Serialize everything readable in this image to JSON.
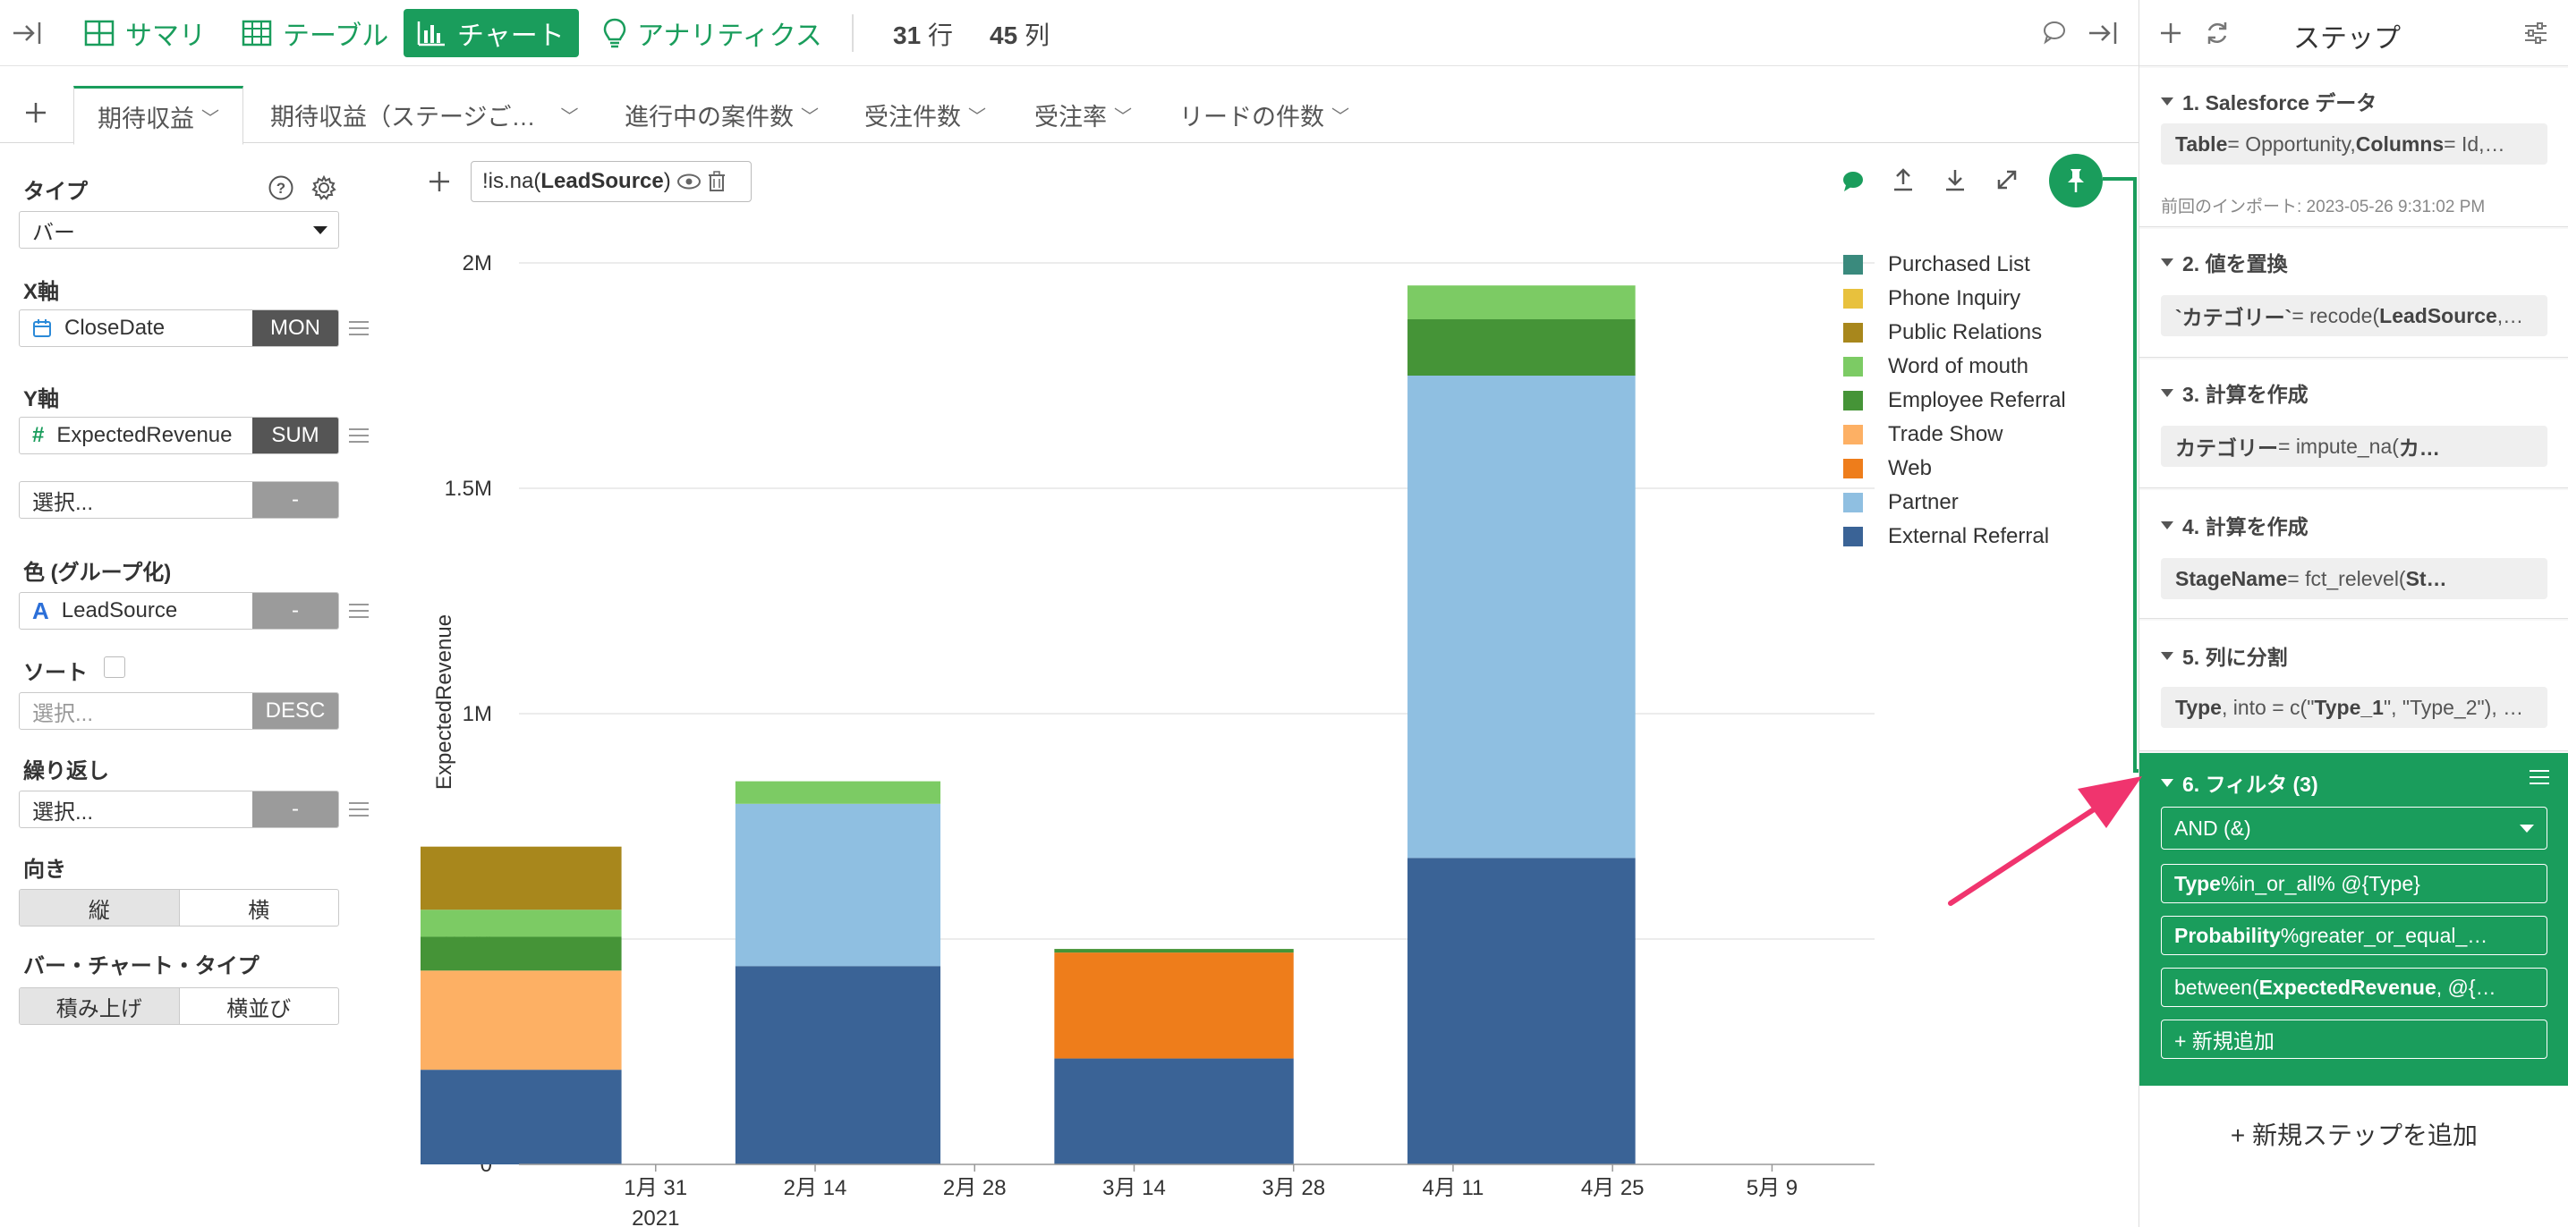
{
  "toolbar": {
    "views": [
      {
        "label": "サマリ",
        "icon": "grid-icon"
      },
      {
        "label": "テーブル",
        "icon": "table-icon"
      },
      {
        "label": "チャート",
        "icon": "bar-chart-icon"
      },
      {
        "label": "アナリティクス",
        "icon": "lightbulb-icon"
      }
    ],
    "rows_count": "31",
    "rows_unit": "行",
    "cols_count": "45",
    "cols_unit": "列"
  },
  "tabs": [
    {
      "label": "期待収益"
    },
    {
      "label": "期待収益（ステージご…"
    },
    {
      "label": "進行中の案件数"
    },
    {
      "label": "受注件数"
    },
    {
      "label": "受注率"
    },
    {
      "label": "リードの件数"
    }
  ],
  "settings": {
    "type_label": "タイプ",
    "type_value": "バー",
    "x_label": "X軸",
    "x_field": "CloseDate",
    "x_agg": "MON",
    "y_label": "Y軸",
    "y_field": "ExpectedRevenue",
    "y_agg": "SUM",
    "y2_placeholder": "選択...",
    "y2_agg": "-",
    "color_label": "色 (グループ化)",
    "color_field": "LeadSource",
    "color_agg": "-",
    "sort_label": "ソート",
    "sort_placeholder": "選択...",
    "sort_agg": "DESC",
    "repeat_label": "繰り返し",
    "repeat_placeholder": "選択...",
    "repeat_agg": "-",
    "orient_label": "向き",
    "orient_options": [
      "縦",
      "横"
    ],
    "bar_type_label": "バー・チャート・タイプ",
    "bar_type_options": [
      "積み上げ",
      "横並び"
    ]
  },
  "filter_chip": {
    "prefix": "!is.na(",
    "field": "LeadSource",
    "suffix": ")"
  },
  "chart_data": {
    "type": "bar",
    "stacked": true,
    "ylabel": "ExpectedRevenue",
    "ylim": [
      0,
      2000000
    ],
    "yticks": [
      {
        "v": 0,
        "label": "0"
      },
      {
        "v": 500000,
        "label": "0.5M"
      },
      {
        "v": 1000000,
        "label": "1M"
      },
      {
        "v": 1500000,
        "label": "1.5M"
      },
      {
        "v": 2000000,
        "label": "2M"
      }
    ],
    "xdomain": [
      "2021-01-19",
      "2021-05-18"
    ],
    "xticks": [
      {
        "date": "2021-01-31",
        "label": "1月 31",
        "sub": "2021"
      },
      {
        "date": "2021-02-14",
        "label": "2月 14"
      },
      {
        "date": "2021-02-28",
        "label": "2月 28"
      },
      {
        "date": "2021-03-14",
        "label": "3月 14"
      },
      {
        "date": "2021-03-28",
        "label": "3月 28"
      },
      {
        "date": "2021-04-11",
        "label": "4月 11"
      },
      {
        "date": "2021-04-25",
        "label": "4月 25"
      },
      {
        "date": "2021-05-09",
        "label": "5月 9"
      }
    ],
    "categories": [
      "2021-01",
      "2021-02",
      "2021-03",
      "2021-04"
    ],
    "series": [
      {
        "name": "Purchased List",
        "color": "#3a8a7d",
        "values": [
          0,
          0,
          0,
          0
        ]
      },
      {
        "name": "Phone Inquiry",
        "color": "#e8c13d",
        "values": [
          0,
          0,
          0,
          0
        ]
      },
      {
        "name": "Public Relations",
        "color": "#a8871c",
        "values": [
          140000,
          0,
          0,
          0
        ]
      },
      {
        "name": "Word of mouth",
        "color": "#7ccb64",
        "values": [
          60000,
          50000,
          0,
          75000
        ]
      },
      {
        "name": "Employee Referral",
        "color": "#459437",
        "values": [
          75000,
          0,
          8000,
          125000
        ]
      },
      {
        "name": "Trade Show",
        "color": "#fdb064",
        "values": [
          220000,
          0,
          0,
          0
        ]
      },
      {
        "name": "Web",
        "color": "#ee7d1b",
        "values": [
          0,
          0,
          235000,
          0
        ]
      },
      {
        "name": "Partner",
        "color": "#8fbfe1",
        "values": [
          0,
          360000,
          0,
          1070000
        ]
      },
      {
        "name": "External Referral",
        "color": "#3a6396",
        "values": [
          210000,
          440000,
          235000,
          680000
        ]
      }
    ],
    "legend_position": "right",
    "grid": true
  },
  "steps_panel": {
    "title": "ステップ",
    "steps": [
      {
        "title": "1. Salesforce データ",
        "body_key": "Table",
        "body_rest": " = Opportunity, ",
        "body_key2": "Columns",
        "body_rest2": " = Id,…",
        "note": "前回のインポート: 2023-05-26 9:31:02 PM"
      },
      {
        "title": "2. 値を置換",
        "body_key": "`カテゴリー`",
        "body_rest": " = recode(",
        "body_key2": "LeadSource",
        "body_rest2": ",…"
      },
      {
        "title": "3. 計算を作成",
        "body_key": "カテゴリー",
        "body_rest": " = impute_na(",
        "body_key2": "カ…",
        "body_rest2": ""
      },
      {
        "title": "4. 計算を作成",
        "body_key": "StageName",
        "body_rest": " = fct_relevel(",
        "body_key2": "St…",
        "body_rest2": ""
      },
      {
        "title": "5. 列に分割",
        "body_key": "Type",
        "body_rest": ", into = c(\"",
        "body_key2": "Type_1",
        "body_rest2": "\", \"Type_2\"), …"
      }
    ],
    "filter_step": {
      "title": "6. フィルタ (3)",
      "logic": "AND (&)",
      "conditions": [
        {
          "key": "Type",
          "rest": " %in_or_all% @{Type}"
        },
        {
          "key": "Probability",
          "rest": " %greater_or_equal_…"
        },
        {
          "pre": "between(",
          "key": "ExpectedRevenue",
          "rest": ", @{…"
        }
      ],
      "add_label": "+ 新規追加"
    },
    "add_step_label": "+ 新規ステップを追加"
  },
  "colors": {
    "accent": "#1a9d5c",
    "arrow": "#f0346e"
  }
}
